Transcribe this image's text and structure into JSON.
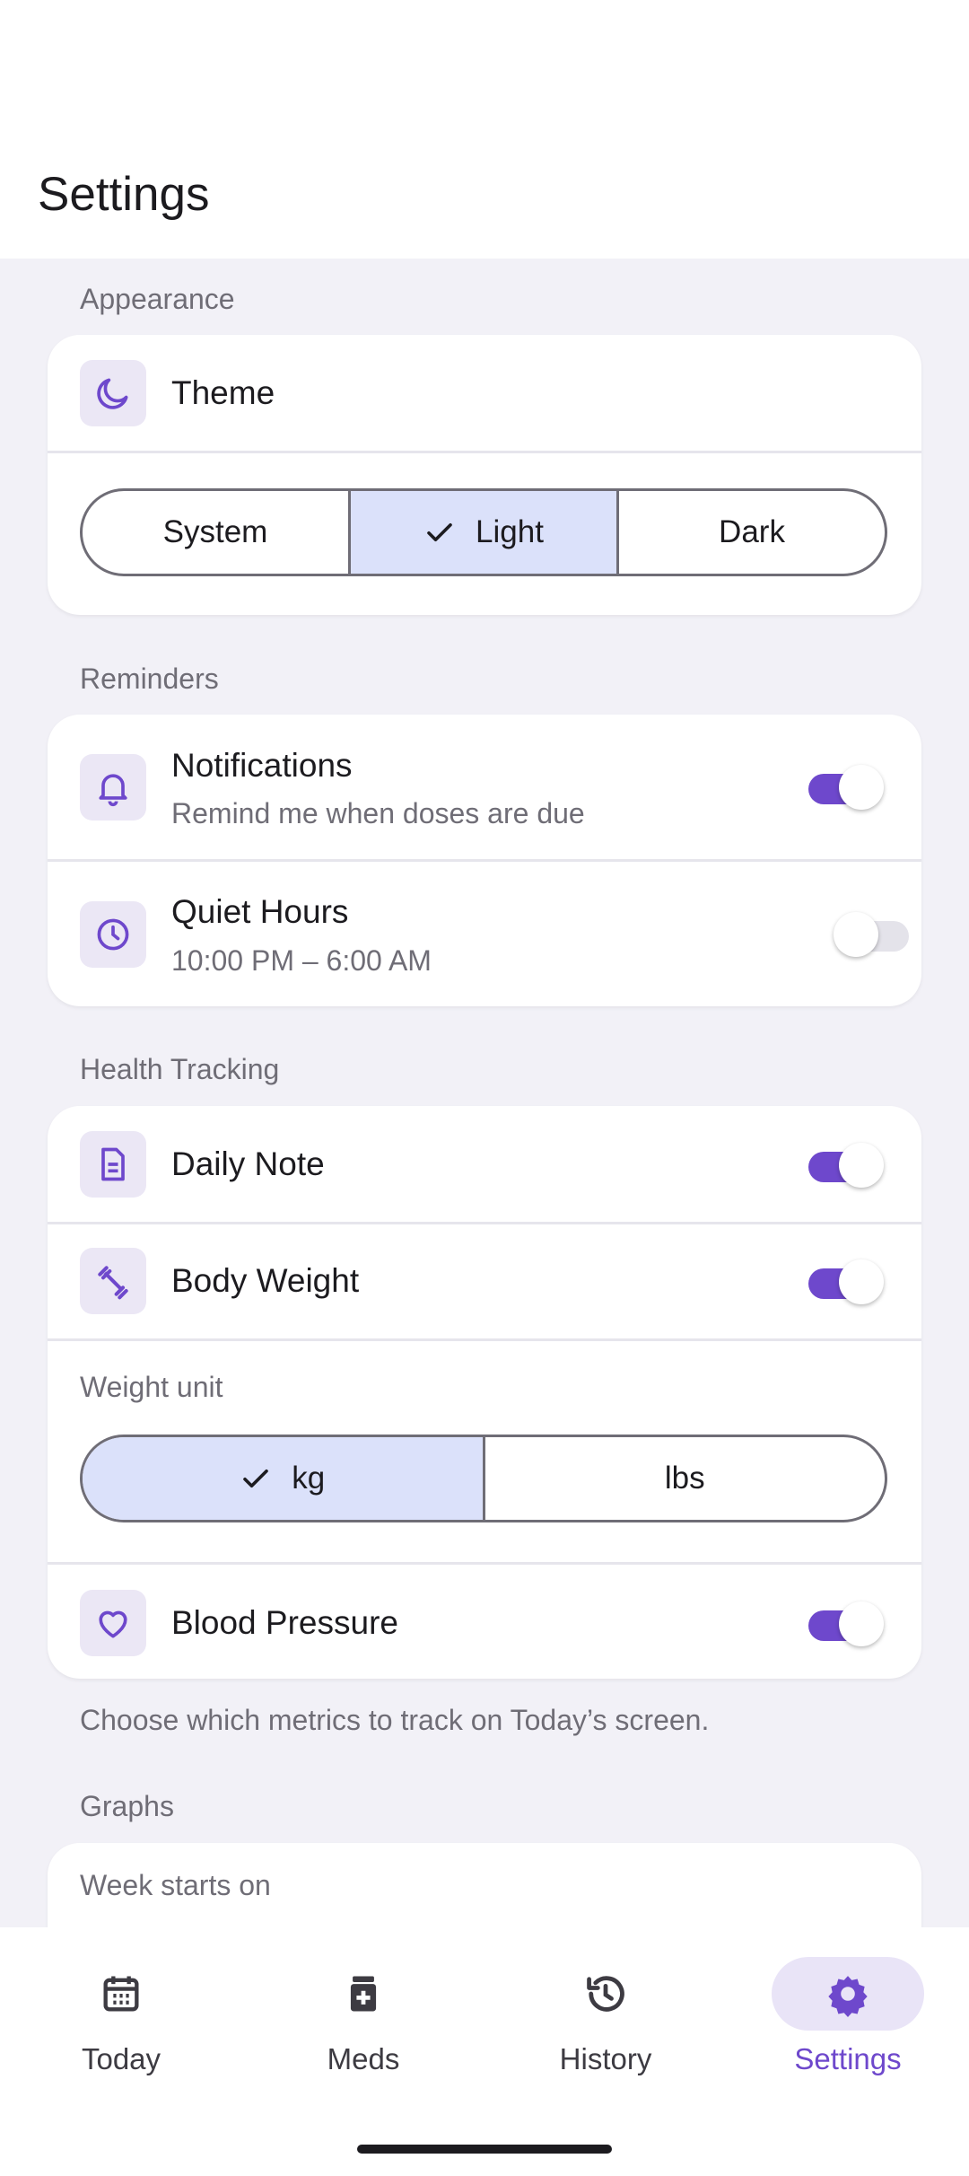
{
  "header": {
    "title": "Settings"
  },
  "appearance": {
    "label": "Appearance",
    "theme_title": "Theme",
    "theme_options": [
      "System",
      "Light",
      "Dark"
    ],
    "theme_selected": "Light"
  },
  "reminders": {
    "label": "Reminders",
    "notifications": {
      "title": "Notifications",
      "subtitle": "Remind me when doses are due",
      "enabled": true
    },
    "quiet_hours": {
      "title": "Quiet Hours",
      "subtitle": "10:00 PM – 6:00 AM",
      "enabled": false
    }
  },
  "health": {
    "label": "Health Tracking",
    "daily_note": {
      "title": "Daily Note",
      "enabled": true
    },
    "body_weight": {
      "title": "Body Weight",
      "enabled": true
    },
    "weight_unit_label": "Weight unit",
    "weight_units": [
      "kg",
      "lbs"
    ],
    "weight_unit_selected": "kg",
    "blood_pressure": {
      "title": "Blood Pressure",
      "enabled": true
    },
    "helper": "Choose which metrics to track on Today’s screen."
  },
  "graphs": {
    "label": "Graphs",
    "week_start_label": "Week starts on"
  },
  "nav": {
    "items": [
      "Today",
      "Meds",
      "History",
      "Settings"
    ],
    "active": "Settings"
  },
  "colors": {
    "accent": "#6e48cc",
    "selected_segment": "#dbe1fa",
    "icon_bg": "#ebe7f5",
    "background": "#f2f1f7"
  },
  "icons": {
    "theme": "moon-icon",
    "notifications": "bell-icon",
    "quiet_hours": "clock-icon",
    "daily_note": "document-icon",
    "body_weight": "dumbbell-icon",
    "blood_pressure": "heart-icon",
    "nav_today": "calendar-icon",
    "nav_meds": "medicine-icon",
    "nav_history": "history-icon",
    "nav_settings": "gear-icon"
  }
}
